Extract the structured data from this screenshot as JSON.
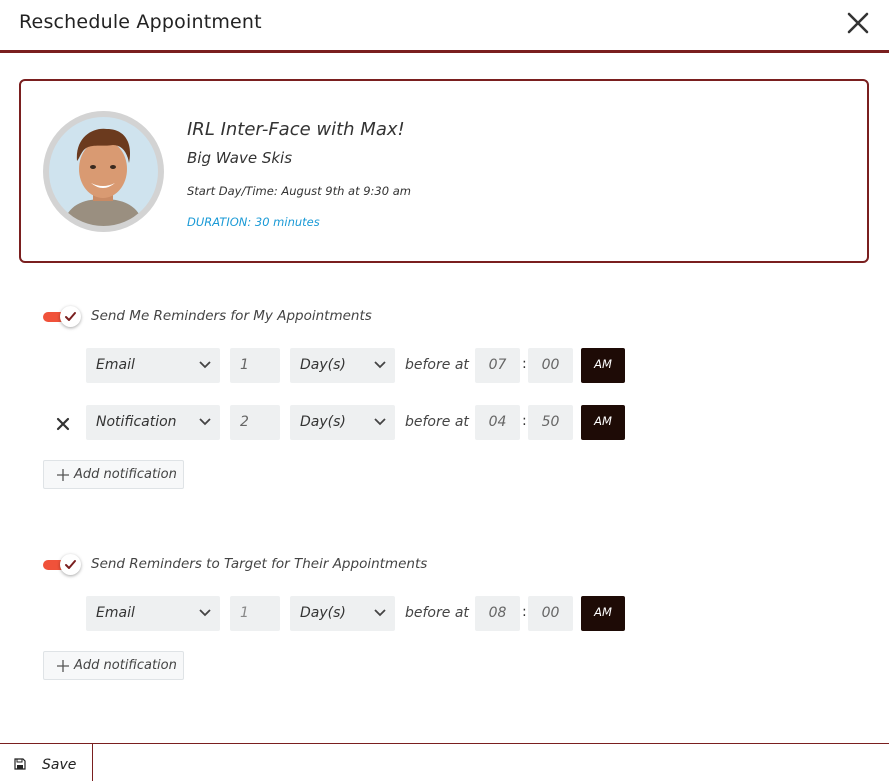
{
  "header": {
    "title": "Reschedule Appointment"
  },
  "appointment": {
    "title": "IRL Inter-Face with Max!",
    "company": "Big Wave Skis",
    "start": "Start Day/Time: August 9th at 9:30 am",
    "duration": "DURATION: 30 minutes"
  },
  "my_reminders": {
    "label": "Send Me Reminders for My Appointments",
    "enabled": true,
    "rows": [
      {
        "type": "Email",
        "amount": "1",
        "unit": "Day(s)",
        "before_at": "before at",
        "hour": "07",
        "minute": "00",
        "ampm": "AM"
      },
      {
        "type": "Notification",
        "amount": "2",
        "unit": "Day(s)",
        "before_at": "before at",
        "hour": "04",
        "minute": "50",
        "ampm": "AM"
      }
    ],
    "add_label": "Add notification"
  },
  "target_reminders": {
    "label": "Send Reminders to Target for Their Appointments",
    "enabled": true,
    "rows": [
      {
        "type": "Email",
        "amount": "1",
        "unit": "Day(s)",
        "before_at": "before at",
        "hour": "08",
        "minute": "00",
        "ampm": "AM"
      }
    ],
    "add_label": "Add notification"
  },
  "footer": {
    "save_label": "Save"
  },
  "colors": {
    "accent": "#7a1f1f",
    "toggle": "#f0523a",
    "duration": "#1a9ad6",
    "ampm_bg": "#1e0b06"
  }
}
